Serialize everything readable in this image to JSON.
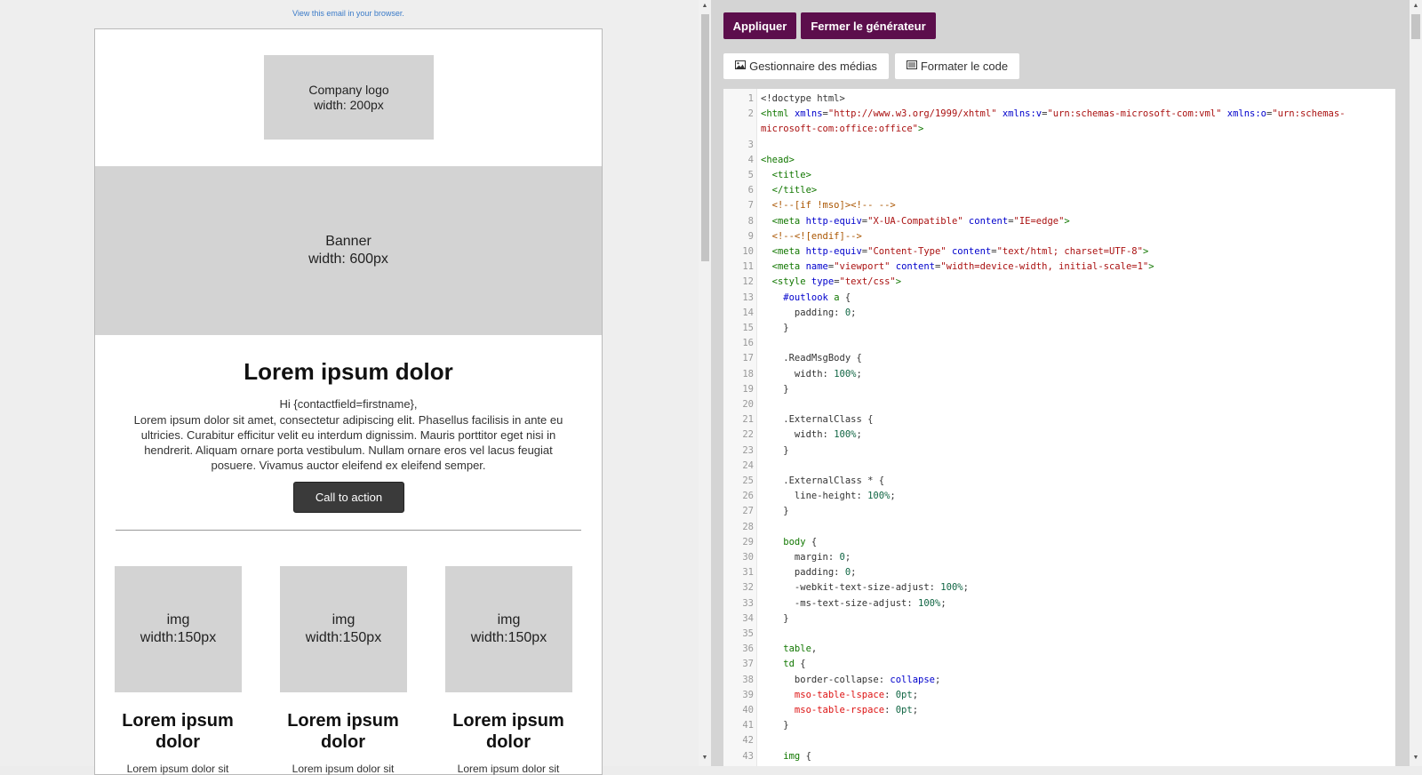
{
  "preview": {
    "view_in_browser": "View this email in your browser.",
    "logo_line1": "Company logo",
    "logo_line2": "width: 200px",
    "banner_line1": "Banner",
    "banner_line2": "width: 600px",
    "heading": "Lorem ipsum dolor",
    "greeting": "Hi {contactfield=firstname},",
    "body": "Lorem ipsum dolor sit amet, consectetur adipiscing elit. Phasellus facilisis in ante eu ultricies. Curabitur efficitur velit eu interdum dignissim. Mauris porttitor eget nisi in hendrerit. Aliquam ornare porta vestibulum. Nullam ornare eros vel lacus feugiat posuere. Vivamus auctor eleifend ex eleifend semper.",
    "cta": "Call to action",
    "columns": [
      {
        "img_line1": "img",
        "img_line2": "width:150px",
        "title": "Lorem ipsum dolor",
        "text": "Lorem ipsum dolor sit"
      },
      {
        "img_line1": "img",
        "img_line2": "width:150px",
        "title": "Lorem ipsum dolor",
        "text": "Lorem ipsum dolor sit"
      },
      {
        "img_line1": "img",
        "img_line2": "width:150px",
        "title": "Lorem ipsum dolor",
        "text": "Lorem ipsum dolor sit"
      }
    ]
  },
  "toolbar": {
    "apply": "Appliquer",
    "close": "Fermer le générateur",
    "media": "Gestionnaire des médias",
    "format": "Formater le code",
    "media_icon": "image-icon",
    "format_icon": "list-icon",
    "accent_color": "#5c0e4c"
  },
  "editor": {
    "lines": [
      [
        {
          "t": "<!doctype html>",
          "c": "#333333"
        }
      ],
      [
        {
          "t": "<html ",
          "c": "#117700"
        },
        {
          "t": "xmlns",
          "c": "#0000cc"
        },
        {
          "t": "=",
          "c": "#333333"
        },
        {
          "t": "\"http://www.w3.org/1999/xhtml\"",
          "c": "#aa1111"
        },
        {
          "t": " ",
          "c": "#333333"
        },
        {
          "t": "xmlns:v",
          "c": "#0000cc"
        },
        {
          "t": "=",
          "c": "#333333"
        },
        {
          "t": "\"urn:schemas-microsoft-com:vml\"",
          "c": "#aa1111"
        },
        {
          "t": " ",
          "c": "#333333"
        },
        {
          "t": "xmlns:o",
          "c": "#0000cc"
        },
        {
          "t": "=",
          "c": "#333333"
        },
        {
          "t": "\"urn:schemas-",
          "c": "#aa1111"
        }
      ],
      [
        {
          "t": "microsoft-com:office:office\"",
          "c": "#aa1111"
        },
        {
          "t": ">",
          "c": "#117700"
        }
      ],
      [],
      [
        {
          "t": "<head>",
          "c": "#117700"
        }
      ],
      [
        {
          "t": "  <title>",
          "c": "#117700"
        }
      ],
      [
        {
          "t": "  </title>",
          "c": "#117700"
        }
      ],
      [
        {
          "t": "  <!--[if !mso]><!-- -->",
          "c": "#aa5500"
        }
      ],
      [
        {
          "t": "  <meta ",
          "c": "#117700"
        },
        {
          "t": "http-equiv",
          "c": "#0000cc"
        },
        {
          "t": "=",
          "c": "#333333"
        },
        {
          "t": "\"X-UA-Compatible\"",
          "c": "#aa1111"
        },
        {
          "t": " ",
          "c": "#333333"
        },
        {
          "t": "content",
          "c": "#0000cc"
        },
        {
          "t": "=",
          "c": "#333333"
        },
        {
          "t": "\"IE=edge\"",
          "c": "#aa1111"
        },
        {
          "t": ">",
          "c": "#117700"
        }
      ],
      [
        {
          "t": "  <!--<![endif]-->",
          "c": "#aa5500"
        }
      ],
      [
        {
          "t": "  <meta ",
          "c": "#117700"
        },
        {
          "t": "http-equiv",
          "c": "#0000cc"
        },
        {
          "t": "=",
          "c": "#333333"
        },
        {
          "t": "\"Content-Type\"",
          "c": "#aa1111"
        },
        {
          "t": " ",
          "c": "#333333"
        },
        {
          "t": "content",
          "c": "#0000cc"
        },
        {
          "t": "=",
          "c": "#333333"
        },
        {
          "t": "\"text/html; charset=UTF-8\"",
          "c": "#aa1111"
        },
        {
          "t": ">",
          "c": "#117700"
        }
      ],
      [
        {
          "t": "  <meta ",
          "c": "#117700"
        },
        {
          "t": "name",
          "c": "#0000cc"
        },
        {
          "t": "=",
          "c": "#333333"
        },
        {
          "t": "\"viewport\"",
          "c": "#aa1111"
        },
        {
          "t": " ",
          "c": "#333333"
        },
        {
          "t": "content",
          "c": "#0000cc"
        },
        {
          "t": "=",
          "c": "#333333"
        },
        {
          "t": "\"width=device-width, initial-scale=1\"",
          "c": "#aa1111"
        },
        {
          "t": ">",
          "c": "#117700"
        }
      ],
      [
        {
          "t": "  <style ",
          "c": "#117700"
        },
        {
          "t": "type",
          "c": "#0000cc"
        },
        {
          "t": "=",
          "c": "#333333"
        },
        {
          "t": "\"text/css\"",
          "c": "#aa1111"
        },
        {
          "t": ">",
          "c": "#117700"
        }
      ],
      [
        {
          "t": "    #outlook ",
          "c": "#0000cc"
        },
        {
          "t": "a",
          "c": "#117700"
        },
        {
          "t": " {",
          "c": "#333333"
        }
      ],
      [
        {
          "t": "      padding: ",
          "c": "#333333"
        },
        {
          "t": "0",
          "c": "#116644"
        },
        {
          "t": ";",
          "c": "#333333"
        }
      ],
      [
        {
          "t": "    }",
          "c": "#333333"
        }
      ],
      [],
      [
        {
          "t": "    .ReadMsgBody {",
          "c": "#333333"
        }
      ],
      [
        {
          "t": "      width: ",
          "c": "#333333"
        },
        {
          "t": "100%",
          "c": "#116644"
        },
        {
          "t": ";",
          "c": "#333333"
        }
      ],
      [
        {
          "t": "    }",
          "c": "#333333"
        }
      ],
      [],
      [
        {
          "t": "    .ExternalClass {",
          "c": "#333333"
        }
      ],
      [
        {
          "t": "      width: ",
          "c": "#333333"
        },
        {
          "t": "100%",
          "c": "#116644"
        },
        {
          "t": ";",
          "c": "#333333"
        }
      ],
      [
        {
          "t": "    }",
          "c": "#333333"
        }
      ],
      [],
      [
        {
          "t": "    .ExternalClass * {",
          "c": "#333333"
        }
      ],
      [
        {
          "t": "      line-height: ",
          "c": "#333333"
        },
        {
          "t": "100%",
          "c": "#116644"
        },
        {
          "t": ";",
          "c": "#333333"
        }
      ],
      [
        {
          "t": "    }",
          "c": "#333333"
        }
      ],
      [],
      [
        {
          "t": "    body",
          "c": "#117700"
        },
        {
          "t": " {",
          "c": "#333333"
        }
      ],
      [
        {
          "t": "      margin: ",
          "c": "#333333"
        },
        {
          "t": "0",
          "c": "#116644"
        },
        {
          "t": ";",
          "c": "#333333"
        }
      ],
      [
        {
          "t": "      padding: ",
          "c": "#333333"
        },
        {
          "t": "0",
          "c": "#116644"
        },
        {
          "t": ";",
          "c": "#333333"
        }
      ],
      [
        {
          "t": "      -webkit-text-size-adjust: ",
          "c": "#333333"
        },
        {
          "t": "100%",
          "c": "#116644"
        },
        {
          "t": ";",
          "c": "#333333"
        }
      ],
      [
        {
          "t": "      -ms-text-size-adjust: ",
          "c": "#333333"
        },
        {
          "t": "100%",
          "c": "#116644"
        },
        {
          "t": ";",
          "c": "#333333"
        }
      ],
      [
        {
          "t": "    }",
          "c": "#333333"
        }
      ],
      [],
      [
        {
          "t": "    table",
          "c": "#117700"
        },
        {
          "t": ",",
          "c": "#333333"
        }
      ],
      [
        {
          "t": "    td",
          "c": "#117700"
        },
        {
          "t": " {",
          "c": "#333333"
        }
      ],
      [
        {
          "t": "      border-collapse: ",
          "c": "#333333"
        },
        {
          "t": "collapse",
          "c": "#0000cc"
        },
        {
          "t": ";",
          "c": "#333333"
        }
      ],
      [
        {
          "t": "      mso-table-lspace",
          "c": "#dd1111"
        },
        {
          "t": ": ",
          "c": "#333333"
        },
        {
          "t": "0pt",
          "c": "#116644"
        },
        {
          "t": ";",
          "c": "#333333"
        }
      ],
      [
        {
          "t": "      mso-table-rspace",
          "c": "#dd1111"
        },
        {
          "t": ": ",
          "c": "#333333"
        },
        {
          "t": "0pt",
          "c": "#116644"
        },
        {
          "t": ";",
          "c": "#333333"
        }
      ],
      [
        {
          "t": "    }",
          "c": "#333333"
        }
      ],
      [],
      [
        {
          "t": "    img",
          "c": "#117700"
        },
        {
          "t": " {",
          "c": "#333333"
        }
      ]
    ]
  }
}
